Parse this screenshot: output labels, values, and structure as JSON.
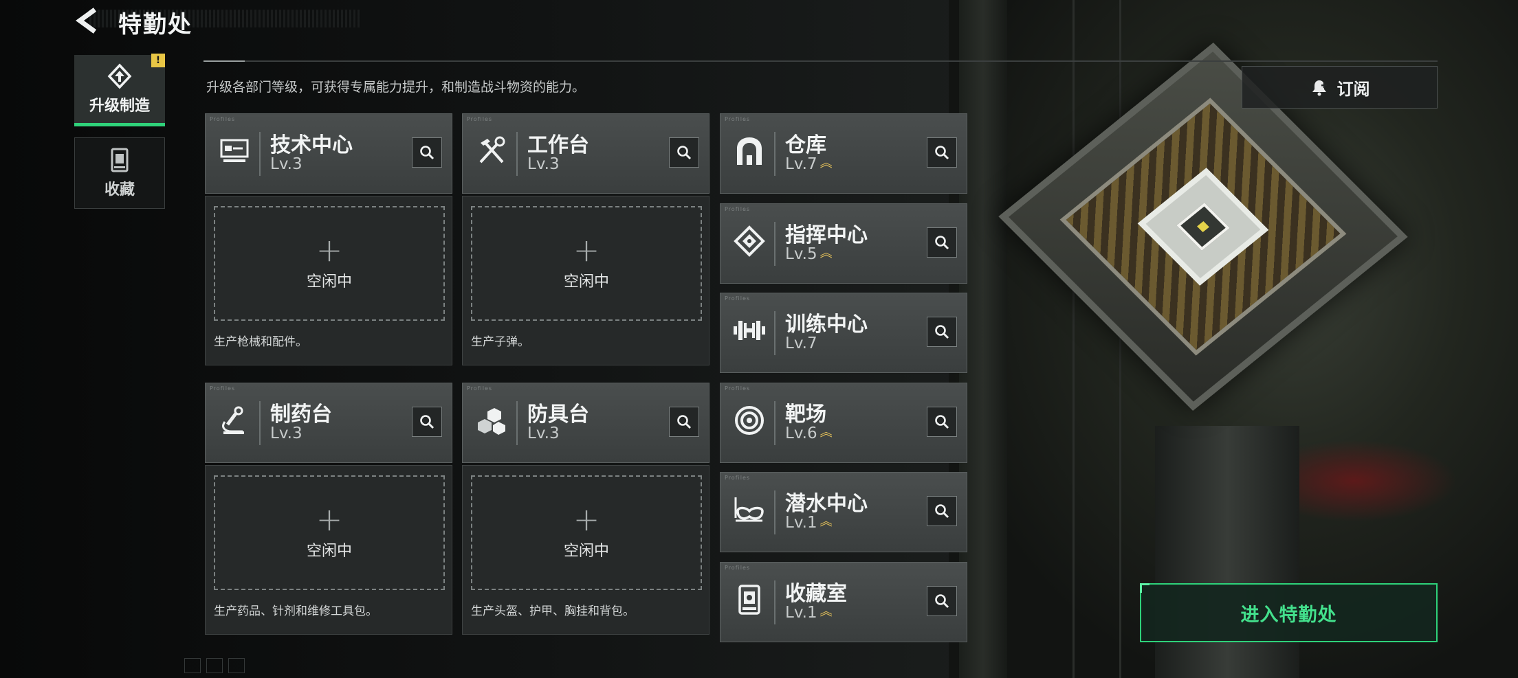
{
  "header": {
    "title": "特勤处",
    "back_icon": "chevron-left-icon"
  },
  "subtitle": "升级各部门等级，可获得专属能力提升，和制造战斗物资的能力。",
  "subscribe_button": {
    "label": "订阅",
    "icon": "bell-plus-icon"
  },
  "sidebar": {
    "items": [
      {
        "label": "升级制造",
        "icon": "upgrade-icon",
        "active": true,
        "badge": "!"
      },
      {
        "label": "收藏",
        "icon": "collection-icon",
        "active": false
      }
    ]
  },
  "card_tag": "Profiles",
  "production": [
    {
      "name": "技术中心",
      "level": "Lv.3",
      "icon": "tech-center-icon",
      "slot_status": "空闲中",
      "description": "生产枪械和配件。"
    },
    {
      "name": "工作台",
      "level": "Lv.3",
      "icon": "workbench-icon",
      "slot_status": "空闲中",
      "description": "生产子弹。"
    },
    {
      "name": "制药台",
      "level": "Lv.3",
      "icon": "pharmacy-icon",
      "slot_status": "空闲中",
      "description": "生产药品、针剂和维修工具包。"
    },
    {
      "name": "防具台",
      "level": "Lv.3",
      "icon": "armor-bench-icon",
      "slot_status": "空闲中",
      "description": "生产头盔、护甲、胸挂和背包。"
    }
  ],
  "departments": [
    {
      "name": "仓库",
      "level": "Lv.7",
      "icon": "warehouse-icon",
      "upgradable": true
    },
    {
      "name": "指挥中心",
      "level": "Lv.5",
      "icon": "command-chip-icon",
      "upgradable": true
    },
    {
      "name": "训练中心",
      "level": "Lv.7",
      "icon": "dumbbell-icon",
      "upgradable": false
    },
    {
      "name": "靶场",
      "level": "Lv.6",
      "icon": "target-icon",
      "upgradable": true
    },
    {
      "name": "潜水中心",
      "level": "Lv.1",
      "icon": "diving-mask-icon",
      "upgradable": true
    },
    {
      "name": "收藏室",
      "level": "Lv.1",
      "icon": "collection-room-icon",
      "upgradable": true
    }
  ],
  "enter_button": {
    "label": "进入特勤处"
  },
  "accent_colors": {
    "green": "#2ed27a",
    "gold": "#e7c35a",
    "badge": "#e8c645"
  }
}
